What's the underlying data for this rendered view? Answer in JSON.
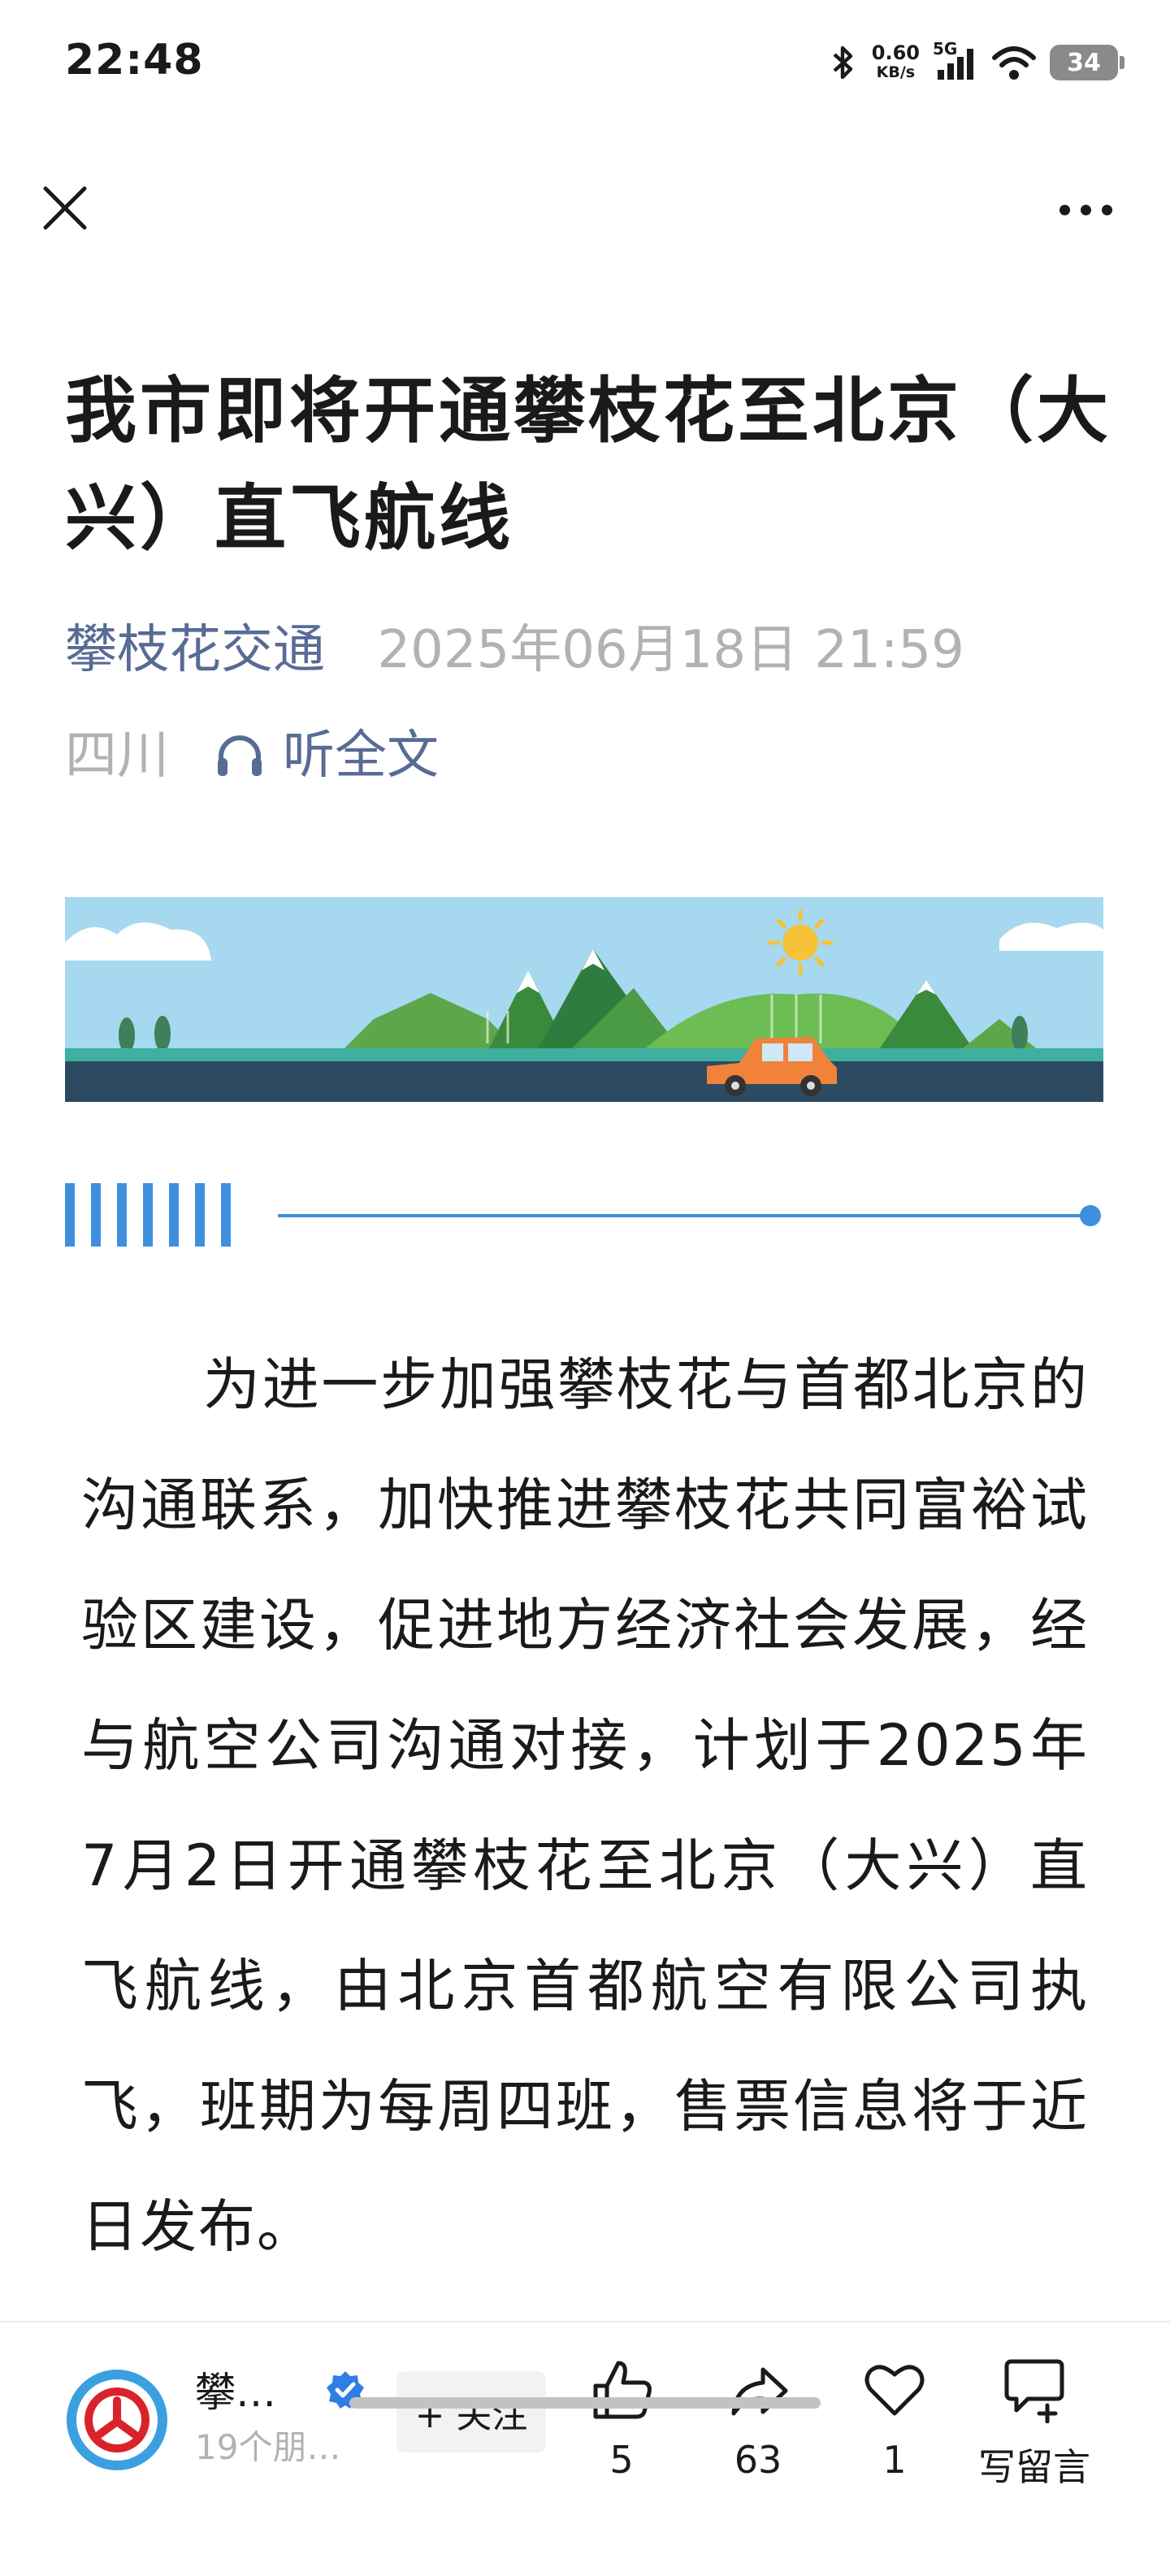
{
  "status_bar": {
    "time": "22:48",
    "net_speed_value": "0.60",
    "net_speed_unit": "KB/s",
    "network_type": "5G",
    "battery": "34",
    "icons": [
      "bluetooth-icon",
      "signal-icon",
      "wifi-icon",
      "battery-icon"
    ]
  },
  "nav": {
    "close_icon": "close-icon",
    "more_icon": "more-icon"
  },
  "article": {
    "title": "我市即将开通攀枝花至北京（大兴）直飞航线",
    "source": "攀枝花交通",
    "datetime": "2025年06月18日 21:59",
    "region": "四川",
    "listen_label": "听全文",
    "body": "为进一步加强攀枝花与首都北京的沟通联系，加快推进攀枝花共同富裕试验区建设，促进地方经济社会发展，经与航空公司沟通对接，计划于2025年7月2日开通攀枝花至北京（大兴）直飞航线，由北京首都航空有限公司执飞，班期为每周四班，售票信息将于近日发布。"
  },
  "bottom_bar": {
    "account_name": "攀…",
    "account_friends": "19个朋…",
    "follow_label": "+ 关注",
    "like_count": "5",
    "share_count": "63",
    "heart_count": "1",
    "comment_label": "写留言"
  },
  "colors": {
    "link": "#576b95",
    "muted": "#b2b2b2",
    "accent_blue": "#3f8fdf",
    "sky": "#a6d8f0"
  }
}
